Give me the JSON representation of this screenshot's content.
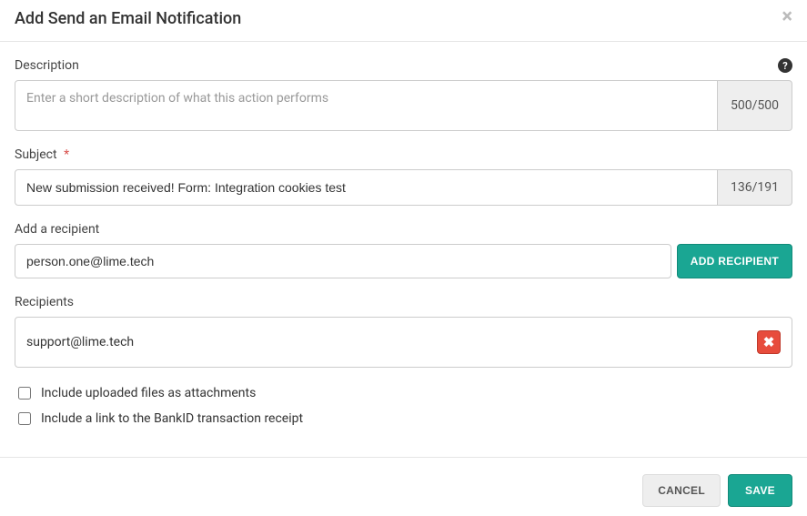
{
  "header": {
    "title": "Add Send an Email Notification",
    "close_glyph": "×"
  },
  "description": {
    "label": "Description",
    "placeholder": "Enter a short description of what this action performs",
    "value": "",
    "counter": "500/500"
  },
  "subject": {
    "label": "Subject",
    "required_mark": "*",
    "value": "New submission received! Form: Integration cookies test",
    "counter": "136/191"
  },
  "add_recipient": {
    "label": "Add a recipient",
    "value": "person.one@lime.tech",
    "button": "ADD RECIPIENT"
  },
  "recipients": {
    "label": "Recipients",
    "items": [
      {
        "email": "support@lime.tech"
      }
    ],
    "remove_glyph": "✖"
  },
  "options": {
    "attachments_label": "Include uploaded files as attachments",
    "attachments_checked": false,
    "bankid_label": "Include a link to the BankID transaction receipt",
    "bankid_checked": false
  },
  "footer": {
    "cancel": "CANCEL",
    "save": "SAVE"
  }
}
